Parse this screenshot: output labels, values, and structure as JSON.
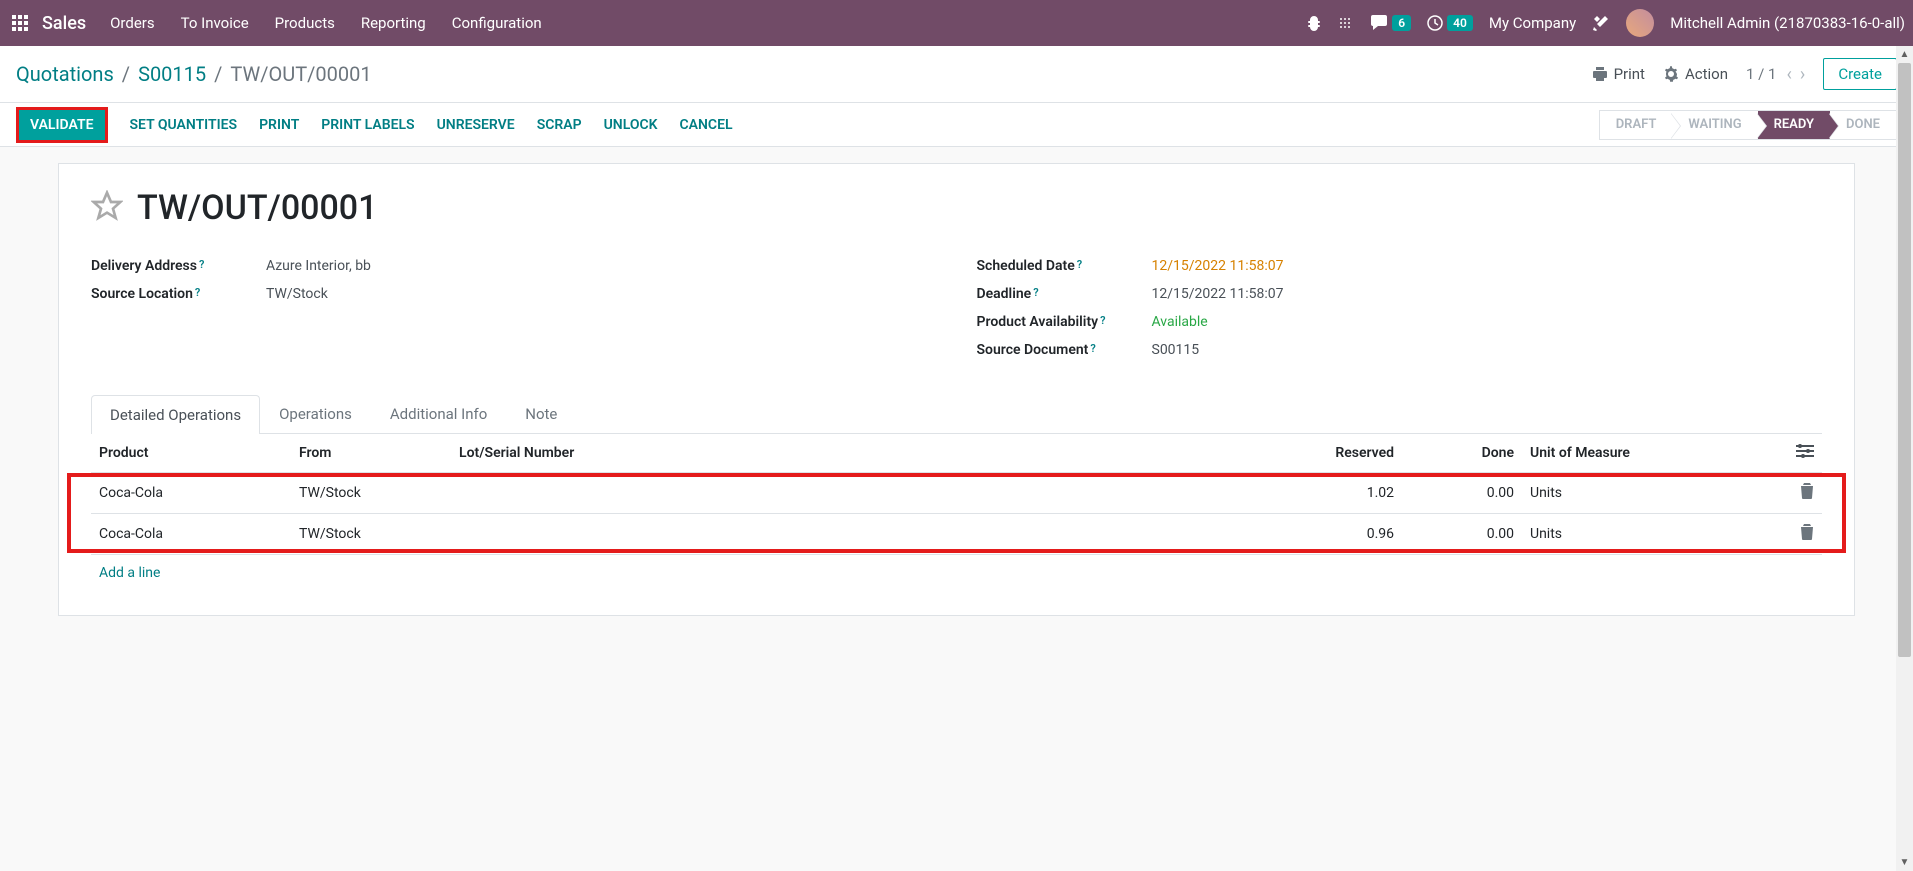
{
  "topnav": {
    "brand": "Sales",
    "menu": [
      "Orders",
      "To Invoice",
      "Products",
      "Reporting",
      "Configuration"
    ],
    "messages_badge": "6",
    "activities_badge": "40",
    "company": "My Company",
    "user": "Mitchell Admin (21870383-16-0-all)"
  },
  "breadcrumb": {
    "items": [
      "Quotations",
      "S00115"
    ],
    "current": "TW/OUT/00001"
  },
  "controlbar": {
    "print": "Print",
    "action": "Action",
    "pager": "1 / 1",
    "create": "Create"
  },
  "statusbar": {
    "validate": "VALIDATE",
    "actions": [
      "SET QUANTITIES",
      "PRINT",
      "PRINT LABELS",
      "UNRESERVE",
      "SCRAP",
      "UNLOCK",
      "CANCEL"
    ],
    "stages": [
      {
        "label": "DRAFT",
        "active": false
      },
      {
        "label": "WAITING",
        "active": false
      },
      {
        "label": "READY",
        "active": true
      },
      {
        "label": "DONE",
        "active": false
      }
    ]
  },
  "record": {
    "title": "TW/OUT/00001",
    "left": [
      {
        "label": "Delivery Address",
        "value": "Azure Interior, bb",
        "help": true
      },
      {
        "label": "Source Location",
        "value": "TW/Stock",
        "help": true
      }
    ],
    "right": [
      {
        "label": "Scheduled Date",
        "value": "12/15/2022 11:58:07",
        "class": "val-orange",
        "help": true
      },
      {
        "label": "Deadline",
        "value": "12/15/2022 11:58:07",
        "help": true
      },
      {
        "label": "Product Availability",
        "value": "Available",
        "class": "val-green",
        "help": true
      },
      {
        "label": "Source Document",
        "value": "S00115",
        "help": true
      }
    ]
  },
  "tabs": [
    "Detailed Operations",
    "Operations",
    "Additional Info",
    "Note"
  ],
  "table": {
    "headers": {
      "product": "Product",
      "from": "From",
      "lot": "Lot/Serial Number",
      "reserved": "Reserved",
      "done": "Done",
      "uom": "Unit of Measure"
    },
    "rows": [
      {
        "product": "Coca-Cola",
        "from": "TW/Stock",
        "lot": "",
        "reserved": "1.02",
        "done": "0.00",
        "uom": "Units"
      },
      {
        "product": "Coca-Cola",
        "from": "TW/Stock",
        "lot": "",
        "reserved": "0.96",
        "done": "0.00",
        "uom": "Units"
      }
    ],
    "add_line": "Add a line"
  }
}
